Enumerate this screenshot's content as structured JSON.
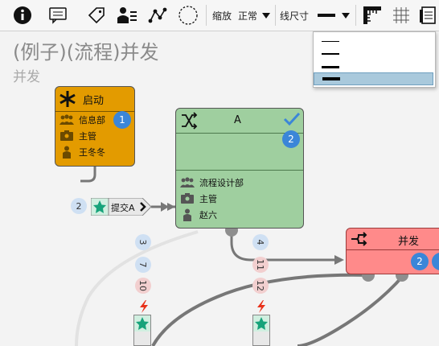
{
  "toolbar": {
    "zoom_label": "缩放",
    "zoom_value": "正常",
    "linesize_label": "线尺寸"
  },
  "dropdown": {
    "options": [
      "细",
      "中",
      "粗",
      "特粗"
    ],
    "selected_index": 3
  },
  "canvas": {
    "title": "(例子)(流程)并发",
    "subtitle": "并发"
  },
  "nodes": {
    "start": {
      "title": "启动",
      "badge": "1",
      "dept": "信息部",
      "role": "主管",
      "user": "王冬冬",
      "color": "#e39b00"
    },
    "a": {
      "title": "A",
      "badge": "2",
      "dept": "流程设计部",
      "role": "主管",
      "user": "赵六",
      "color": "#9fcf9f"
    },
    "parallel": {
      "title": "并发",
      "badge": "2",
      "color": "#ff8a8a"
    }
  },
  "transition": {
    "label": "提交A",
    "order": "2"
  },
  "pills": {
    "left": [
      "3",
      "7",
      "10"
    ],
    "right": [
      "4",
      "11",
      "12"
    ]
  },
  "colors": {
    "accent": "#3b86d8",
    "check": "#3b86d8",
    "star": "#17a37a",
    "bolt": "#e8311a"
  }
}
